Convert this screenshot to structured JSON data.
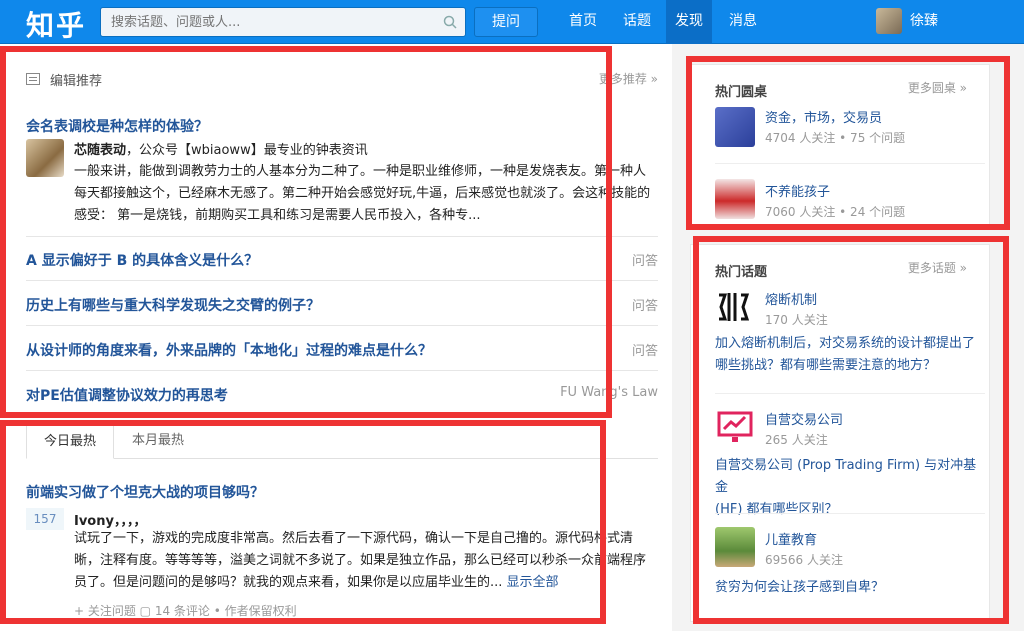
{
  "header": {
    "logo": "知乎",
    "search_placeholder": "搜索话题、问题或人...",
    "ask_button": "提问",
    "nav": [
      "首页",
      "话题",
      "发现",
      "消息"
    ],
    "active_nav": "发现",
    "username": "徐臻"
  },
  "editor_picks": {
    "title": "编辑推荐",
    "more": "更多推荐 »",
    "featured": {
      "question": "会名表调校是种怎样的体验？",
      "author_name": "芯随表动",
      "author_bio": "，公众号【wbiaoww】最专业的钟表资讯",
      "excerpt_lines": [
        "一般来讲，能做到调教劳力士的人基本分为二种了。一种是职业维修师，一种是发烧表友。第一种人",
        "每天都接触这个，已经麻木无感了。第二种开始会感觉好玩,牛逼，后来感觉也就淡了。会这种技能的",
        "感受： 第一是烧钱，前期购买工具和练习是需要人民币投入，各种专..."
      ]
    },
    "items": [
      {
        "question": "A 显示偏好于 B 的具体含义是什么？",
        "tag": "问答"
      },
      {
        "question": "历史上有哪些与重大科学发现失之交臂的例子？",
        "tag": "问答"
      },
      {
        "question": "从设计师的角度来看，外来品牌的「本地化」过程的难点是什么？",
        "tag": "问答"
      },
      {
        "question": "对PE估值调整协议效力的再思考",
        "tag": "FU Wang's Law"
      }
    ]
  },
  "hot": {
    "tabs": [
      "今日最热",
      "本月最热"
    ],
    "active_tab": "今日最热",
    "question": "前端实习做了个坦克大战的项目够吗？",
    "votes": "157",
    "author": "Ivony，，，，",
    "excerpt_lines": [
      "试玩了一下，游戏的完成度非常高。然后去看了一下源代码，确认一下是自己撸的。源代码格式清",
      "晰，注释有度。等等等等，溢美之词就不多说了。如果是独立作品，那么已经可以秒杀一众前端程序",
      "员了。但是问题问的是够吗？就我的观点来看，如果你是以应届毕业生的..."
    ],
    "show_all": "显示全部",
    "meta": "+ 关注问题   ▢ 14 条评论  •  作者保留权利"
  },
  "roundtables": {
    "title": "热门圆桌",
    "more": "更多圆桌 »",
    "items": [
      {
        "name": "资金，市场，交易员",
        "stats": "4704 人关注  •  75 个问题"
      },
      {
        "name": "不养能孩子",
        "stats": "7060 人关注  •  24 个问题"
      }
    ]
  },
  "topics": {
    "title": "热门话题",
    "more": "更多话题 »",
    "items": [
      {
        "name": "熔断机制",
        "followers": "170 人关注",
        "question_lines": [
          "加入熔断机制后，对交易系统的设计都提出了",
          "哪些挑战？都有哪些需要注意的地方？"
        ]
      },
      {
        "name": "自营交易公司",
        "followers": "265 人关注",
        "question_lines": [
          "自营交易公司 (Prop Trading Firm) 与对冲基金",
          "(HF) 都有哪些区别？"
        ]
      },
      {
        "name": "儿童教育",
        "followers": "69566 人关注",
        "question_lines": [
          "贫穷为何会让孩子感到自卑？"
        ]
      }
    ]
  },
  "colors": {
    "brand": "#0f88eb",
    "link": "#225599",
    "highlight_box": "#ee3333"
  }
}
